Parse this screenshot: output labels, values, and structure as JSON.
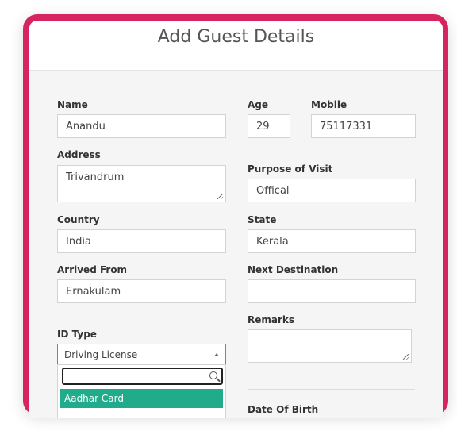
{
  "form": {
    "title": "Add Guest Details",
    "name": {
      "label": "Name",
      "value": "Anandu"
    },
    "age": {
      "label": "Age",
      "value": "29"
    },
    "mobile": {
      "label": "Mobile",
      "value": "75117331"
    },
    "address": {
      "label": "Address",
      "value": "Trivandrum"
    },
    "purpose": {
      "label": "Purpose of Visit",
      "value": "Offical"
    },
    "country": {
      "label": "Country",
      "value": "India"
    },
    "state": {
      "label": "State",
      "value": "Kerala"
    },
    "arrived_from": {
      "label": "Arrived From",
      "value": "Ernakulam"
    },
    "next_destination": {
      "label": "Next Destination",
      "value": ""
    },
    "id_type": {
      "label": "ID Type",
      "selected": "Driving License",
      "search_value": "",
      "highlighted_option": "Aadhar Card"
    },
    "remarks": {
      "label": "Remarks",
      "value": ""
    },
    "dob": {
      "label": "Date Of Birth"
    }
  },
  "colors": {
    "frame": "#d6245e",
    "accent": "#20ac8a"
  }
}
